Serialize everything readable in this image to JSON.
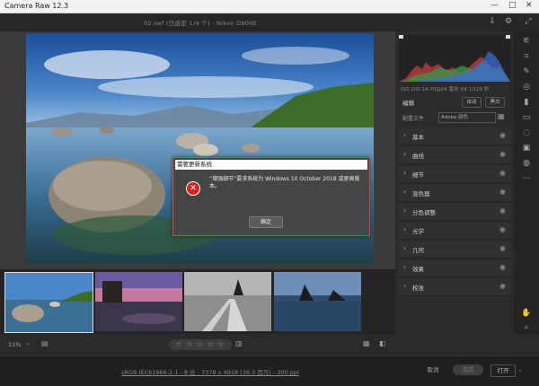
{
  "window": {
    "title": "Camera Raw 12.3",
    "min": "—",
    "max": "□",
    "close": "✕"
  },
  "topbar": {
    "file_info": "02.nef  (已选定 1/4 个)  ·  Nikon D800E",
    "save_icon": "⇩",
    "gear_icon": "⚙",
    "expand_icon": "⤢"
  },
  "dialog": {
    "title": "需要更新系统",
    "icon": "✕",
    "message": "“增强细节”要求系统为 Windows 10 October 2018 或更高版本。",
    "ok_label": "确定"
  },
  "panel": {
    "exif": "ISO 100   24-70@24 毫米   f/9   1/125 秒",
    "edit_label": "编辑",
    "auto_label": "自动",
    "bw_label": "黑白",
    "profile_label": "配置文件",
    "profile_value": "Adobe 颜色",
    "sections": [
      "基本",
      "曲线",
      "细节",
      "混色器",
      "分色调整",
      "光学",
      "几何",
      "效果",
      "校准"
    ]
  },
  "bottombar": {
    "zoom": "11%",
    "stars": "☆ ☆ ☆ ☆ ☆"
  },
  "footer": {
    "info": "sRGB IEC61966-2.1 - 8 位 - 7378 x 4918 (36.3 百万) - 300 ppi",
    "cancel_label": "取消",
    "done_label": "完成",
    "open_label": "打开"
  },
  "colors": {
    "accent": "#d44444",
    "panel_bg": "#2b2b2b",
    "dialog_bg": "#454545"
  }
}
